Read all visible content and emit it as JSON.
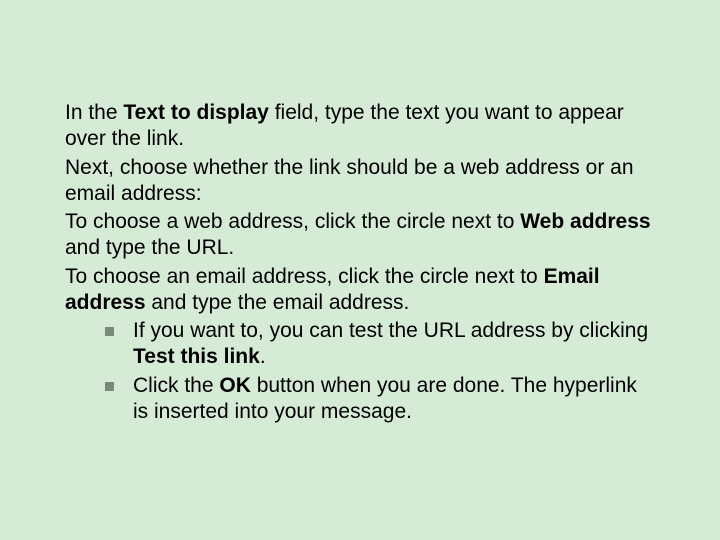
{
  "p1": {
    "t1": "In the ",
    "b1": "Text to display",
    "t2": " field, type the text you want to appear over the link."
  },
  "p2": "Next, choose whether the link should be a web address or an email address:",
  "p3": {
    "t1": "To choose a web address, click the circle next to ",
    "b1": "Web address",
    "t2": " and type the URL."
  },
  "p4": {
    "t1": "To choose an email address, click the circle next to ",
    "b1": "Email address",
    "t2": " and type the email address."
  },
  "li1": {
    "t1": "If you want to, you can test the URL address by clicking ",
    "b1": "Test this link",
    "t2": "."
  },
  "li2": {
    "t1": "Click the ",
    "b1": "OK",
    "t2": " button when you are done. The hyperlink is inserted into your message."
  }
}
